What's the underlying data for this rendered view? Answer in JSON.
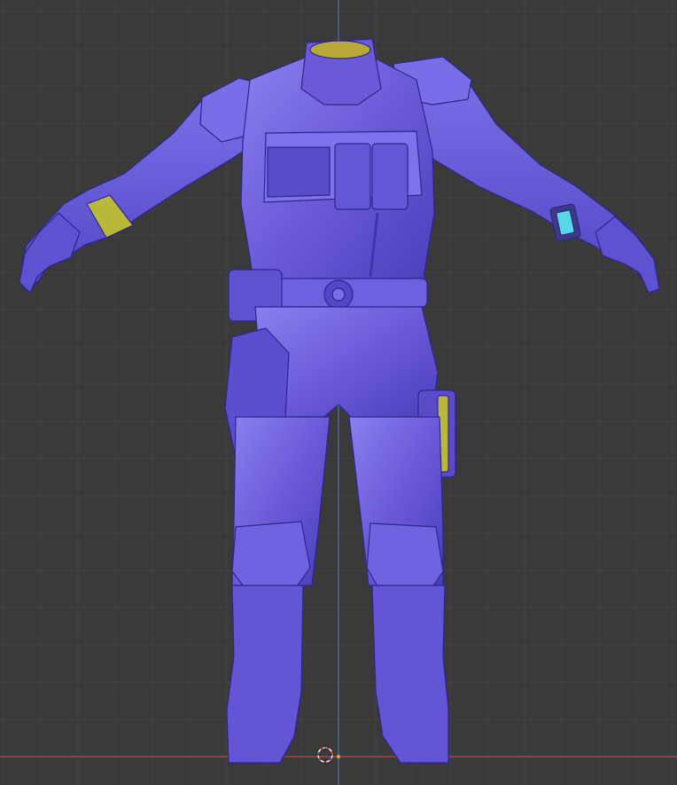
{
  "viewport": {
    "background_color": "#3a3a3a",
    "grid_minor_color": "#424242",
    "grid_major_color": "#4a4a4a",
    "axis_x_color": "#b34a4a",
    "axis_z_color": "#4a78b3"
  },
  "model": {
    "material_base": "#6a5ad8",
    "material_highlight": "#8a7ff0",
    "material_shadow": "#3f34a8",
    "accent_yellow": "#b8b83a",
    "accent_green": "#4fb59a",
    "accent_cyan": "#58d6e8"
  },
  "icons": {
    "origin": "3d-cursor-icon"
  }
}
